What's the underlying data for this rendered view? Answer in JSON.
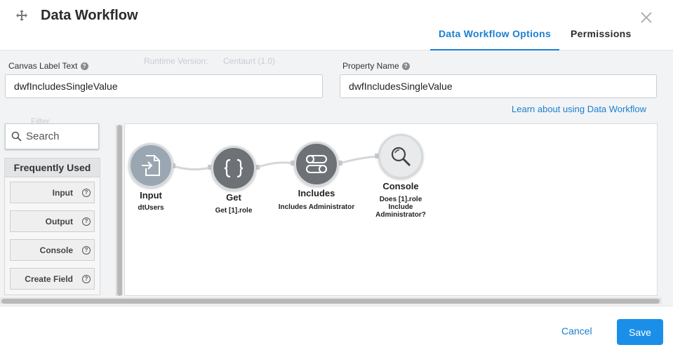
{
  "header": {
    "title": "Data Workflow",
    "tabs": [
      {
        "label": "Data Workflow Options",
        "active": true
      },
      {
        "label": "Permissions",
        "active": false
      }
    ]
  },
  "background_ghost": {
    "runtime_label": "Runtime Version:",
    "runtime_value": "Centaurt (1.0)",
    "filter_label": "Filter"
  },
  "form": {
    "canvas_label": {
      "label": "Canvas Label Text",
      "value": "dwfIncludesSingleValue"
    },
    "property_name": {
      "label": "Property Name",
      "value": "dwfIncludesSingleValue"
    },
    "learn_link": "Learn about using Data Workflow"
  },
  "palette": {
    "search_placeholder": "Search",
    "section_title": "Frequently Used",
    "items": [
      {
        "label": "Input"
      },
      {
        "label": "Output"
      },
      {
        "label": "Console"
      },
      {
        "label": "Create Field"
      }
    ]
  },
  "canvas": {
    "nodes": [
      {
        "title": "Input",
        "subtitle": "dtUsers"
      },
      {
        "title": "Get",
        "subtitle": "Get [1].role"
      },
      {
        "title": "Includes",
        "subtitle": "Includes Administrator"
      },
      {
        "title": "Console",
        "subtitle": "Does [1].role Include Administrator?"
      }
    ]
  },
  "footer": {
    "cancel_label": "Cancel",
    "save_label": "Save"
  },
  "colors": {
    "accent": "#1b7fd0",
    "save_button": "#1b8fe8",
    "node_dark": "#6e7277",
    "node_input": "#9aa7b2"
  }
}
